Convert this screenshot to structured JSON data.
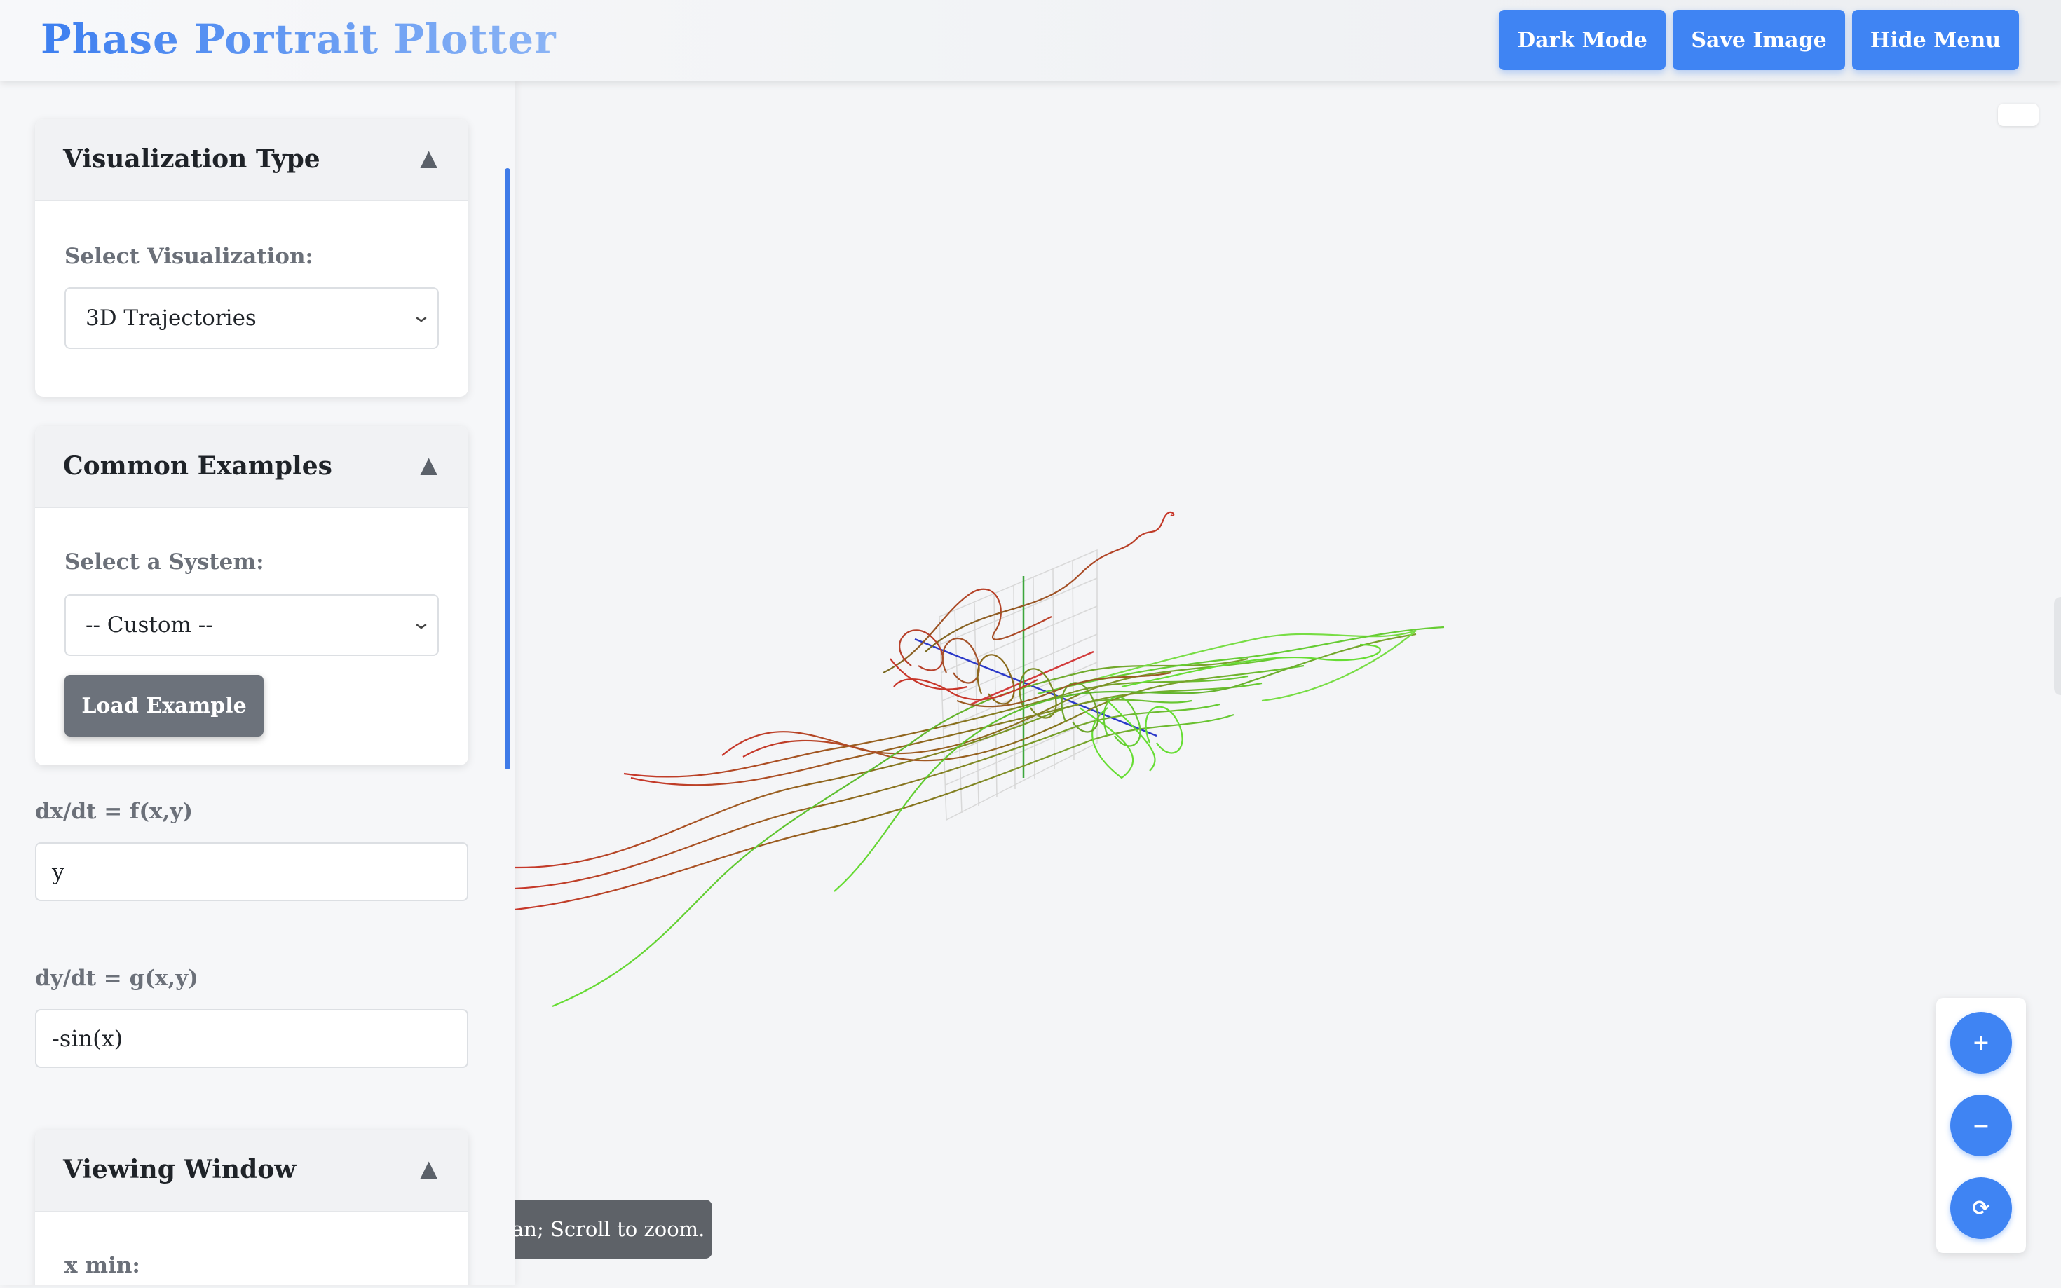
{
  "header": {
    "title": "Phase Portrait Plotter",
    "buttons": {
      "dark_mode": "Dark Mode",
      "save_image": "Save Image",
      "hide_menu": "Hide Menu"
    }
  },
  "sidebar": {
    "visualization_panel": {
      "title": "Visualization Type",
      "toggle": "▲",
      "label": "Select Visualization:",
      "selected": "3D Trajectories"
    },
    "examples_panel": {
      "title": "Common Examples",
      "toggle": "▲",
      "label": "Select a System:",
      "selected": "-- Custom --",
      "load_button": "Load Example"
    },
    "equations": {
      "dx_label": "dx/dt = f(x,y)",
      "dx_value": "y",
      "dy_label": "dy/dt = g(x,y)",
      "dy_value": "-sin(x)"
    },
    "viewing_panel": {
      "title": "Viewing Window",
      "toggle": "▲",
      "xmin_label": "x min:"
    }
  },
  "plot": {
    "hint": "an; Scroll to zoom.",
    "colors": {
      "start": "#c8362a",
      "mid": "#8a6a1c",
      "end": "#66dd33",
      "axis_x": "#d23b3b",
      "axis_y": "#3ca63c",
      "axis_z": "#2b39c9"
    }
  },
  "zoom_controls": {
    "zoom_in": "+",
    "zoom_out": "−",
    "reset": "⟳"
  }
}
